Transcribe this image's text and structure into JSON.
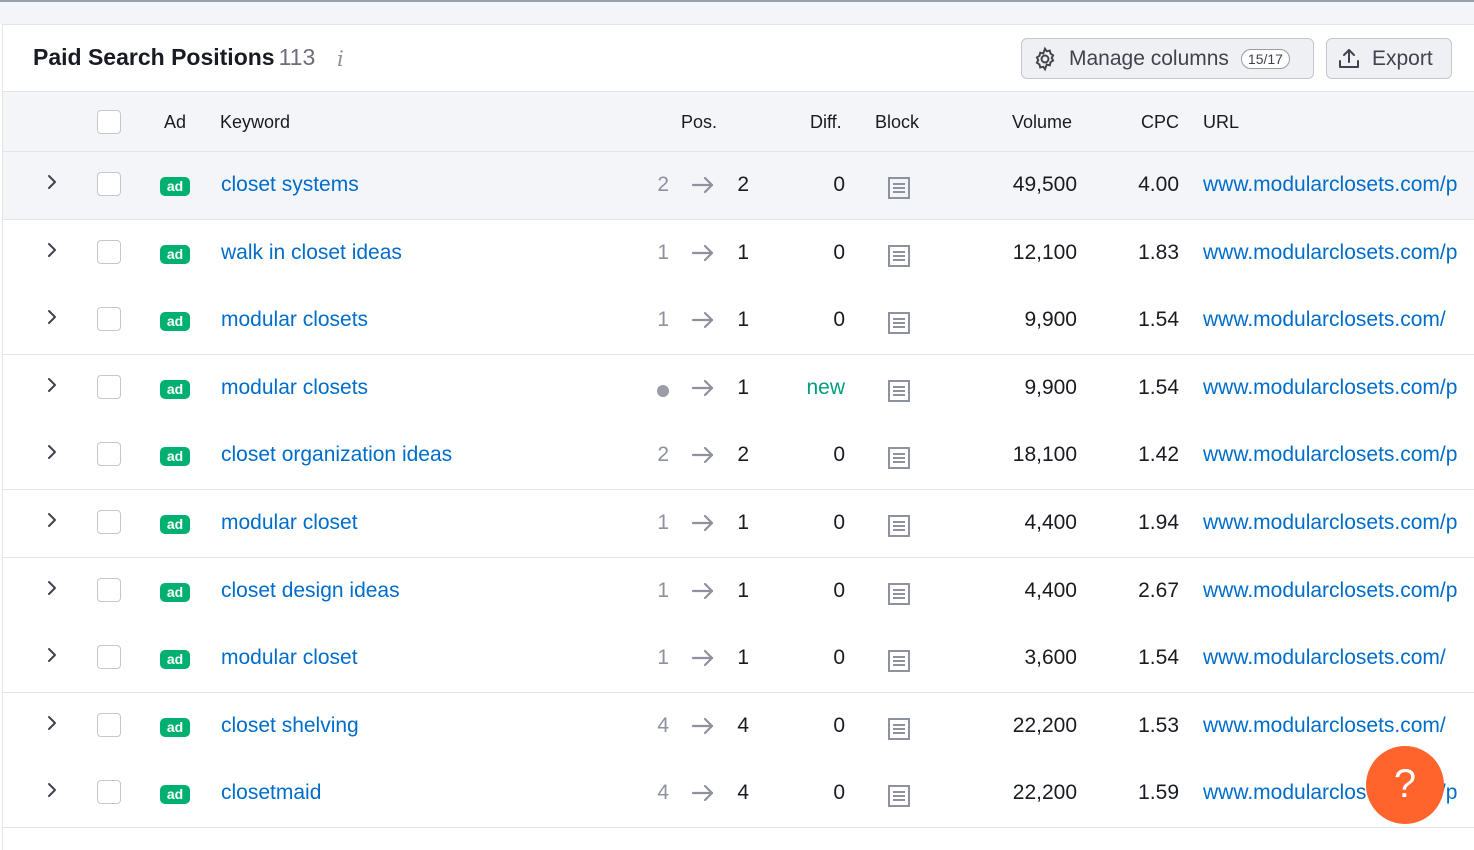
{
  "report": {
    "title": "Paid Search Positions",
    "count": "113",
    "info_glyph": "i"
  },
  "toolbar": {
    "manage_label": "Manage columns",
    "manage_badge": "15/17",
    "export_label": "Export"
  },
  "columns": {
    "ad": "Ad",
    "keyword": "Keyword",
    "pos": "Pos.",
    "diff": "Diff.",
    "block": "Block",
    "volume": "Volume",
    "cpc": "CPC",
    "url": "URL"
  },
  "rows": [
    {
      "keyword": "closet systems",
      "prev": "2",
      "cur": "2",
      "diff": "0",
      "volume": "49,500",
      "cpc": "4.00",
      "url": "www.modularclosets.com/p",
      "highlighted": true
    },
    {
      "keyword": "walk in closet ideas",
      "prev": "1",
      "cur": "1",
      "diff": "0",
      "volume": "12,100",
      "cpc": "1.83",
      "url": "www.modularclosets.com/p"
    },
    {
      "keyword": "modular closets",
      "prev": "1",
      "cur": "1",
      "diff": "0",
      "volume": "9,900",
      "cpc": "1.54",
      "url": "www.modularclosets.com/"
    },
    {
      "keyword": "modular closets",
      "prev": "",
      "cur": "1",
      "diff": "new",
      "volume": "9,900",
      "cpc": "1.54",
      "url": "www.modularclosets.com/p"
    },
    {
      "keyword": "closet organization ideas",
      "prev": "2",
      "cur": "2",
      "diff": "0",
      "volume": "18,100",
      "cpc": "1.42",
      "url": "www.modularclosets.com/p"
    },
    {
      "keyword": "modular closet",
      "prev": "1",
      "cur": "1",
      "diff": "0",
      "volume": "4,400",
      "cpc": "1.94",
      "url": "www.modularclosets.com/p"
    },
    {
      "keyword": "closet design ideas",
      "prev": "1",
      "cur": "1",
      "diff": "0",
      "volume": "4,400",
      "cpc": "2.67",
      "url": "www.modularclosets.com/p"
    },
    {
      "keyword": "modular closet",
      "prev": "1",
      "cur": "1",
      "diff": "0",
      "volume": "3,600",
      "cpc": "1.54",
      "url": "www.modularclosets.com/"
    },
    {
      "keyword": "closet shelving",
      "prev": "4",
      "cur": "4",
      "diff": "0",
      "volume": "22,200",
      "cpc": "1.53",
      "url": "www.modularclosets.com/"
    },
    {
      "keyword": "closetmaid",
      "prev": "4",
      "cur": "4",
      "diff": "0",
      "volume": "22,200",
      "cpc": "1.59",
      "url": "www.modularclosets.com/p"
    }
  ],
  "ad_badge": "ad",
  "help": {
    "glyph": "?"
  },
  "colors": {
    "link": "#006dca",
    "ad_badge": "#00b071",
    "new": "#009f81",
    "help": "#ff642d"
  }
}
